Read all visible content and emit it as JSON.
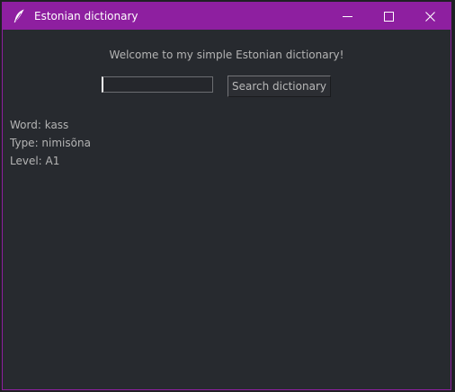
{
  "window": {
    "title": "Estonian dictionary",
    "accent_color": "#8e1fa0",
    "icon": "feather-icon"
  },
  "controls": {
    "minimize_icon": "minimize-icon",
    "maximize_icon": "maximize-icon",
    "close_icon": "close-icon"
  },
  "main": {
    "welcome_text": "Welcome to my simple Estonian dictionary!",
    "search": {
      "value": "",
      "button_label": "Search dictionary"
    },
    "result": {
      "word_line": "Word: kass",
      "type_line": "Type: nimisõna",
      "level_line": "Level: A1"
    }
  }
}
